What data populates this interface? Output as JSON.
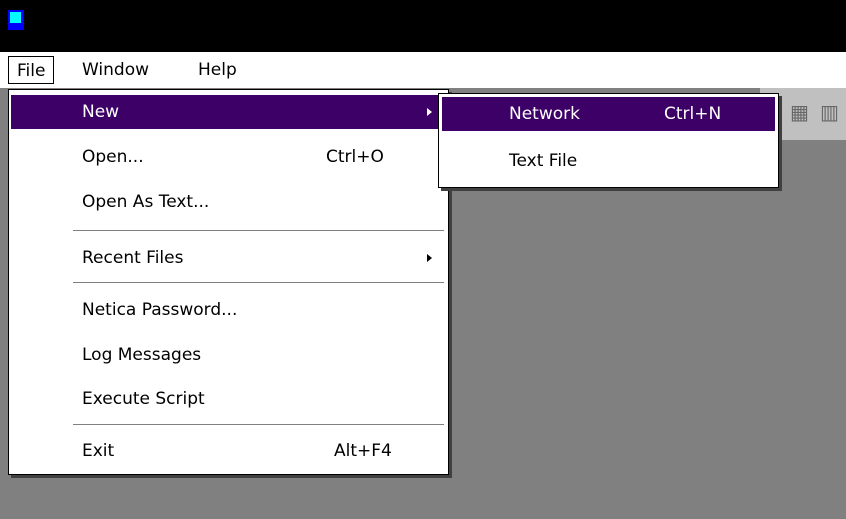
{
  "menubar": {
    "items": [
      "File",
      "Window",
      "Help"
    ]
  },
  "file_menu": {
    "new_label": "New",
    "open_label": "Open...",
    "open_shortcut": "Ctrl+O",
    "open_as_text_label": "Open As Text...",
    "recent_files_label": "Recent Files",
    "netica_password_label": "Netica Password...",
    "log_messages_label": "Log Messages",
    "execute_script_label": "Execute Script",
    "exit_label": "Exit",
    "exit_shortcut": "Alt+F4"
  },
  "new_submenu": {
    "network_label": "Network",
    "network_shortcut": "Ctrl+N",
    "text_file_label": "Text File"
  },
  "colors": {
    "highlight": "#3c0066",
    "workspace": "#808080",
    "titlebar": "#000000"
  },
  "icons": [
    "app-icon",
    "submenu-arrow-icon"
  ]
}
